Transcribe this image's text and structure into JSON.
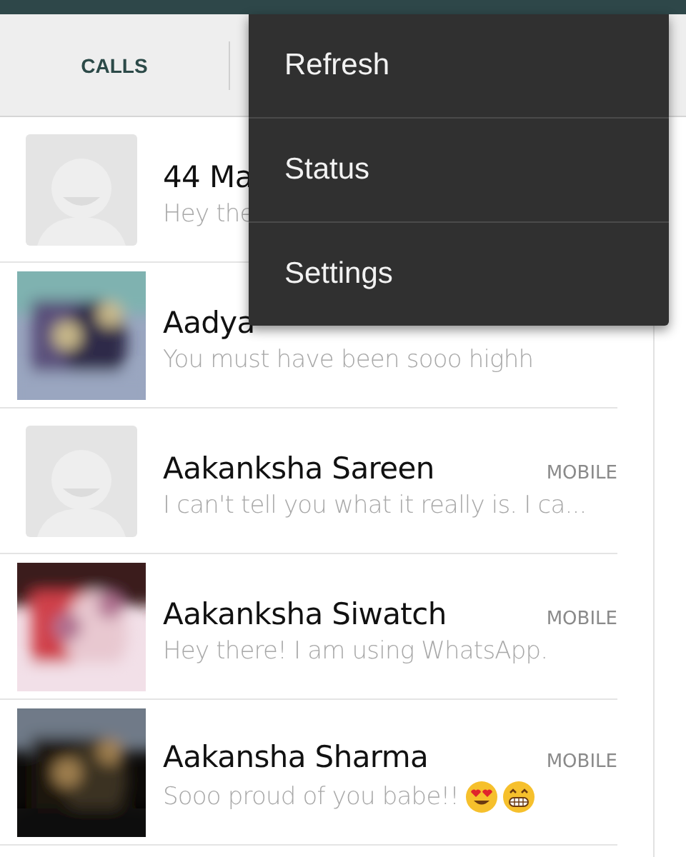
{
  "tabs": [
    {
      "label": "CALLS"
    }
  ],
  "menu": {
    "items": [
      {
        "label": "Refresh"
      },
      {
        "label": "Status"
      },
      {
        "label": "Settings"
      }
    ]
  },
  "contacts": [
    {
      "name": "44 Ma",
      "status": "Hey the",
      "avatar": {
        "kind": "default"
      }
    },
    {
      "name": "Aadya",
      "status": "You must have been sooo highh",
      "avatar": {
        "kind": "picture"
      }
    },
    {
      "name": "Aakanksha Sareen",
      "label": "MOBILE",
      "status": "I can't tell you what it really is. I ca...",
      "avatar": {
        "kind": "default"
      }
    },
    {
      "name": "Aakanksha Siwatch",
      "label": "MOBILE",
      "status": "Hey there! I am using WhatsApp.",
      "avatar": {
        "kind": "picture"
      }
    },
    {
      "name": "Aakansha Sharma",
      "label": "MOBILE",
      "status": "Sooo proud of you babe!!",
      "emojis": [
        {
          "kind": "heart_eyes"
        },
        {
          "kind": "grin"
        }
      ],
      "avatar": {
        "kind": "picture"
      }
    }
  ]
}
